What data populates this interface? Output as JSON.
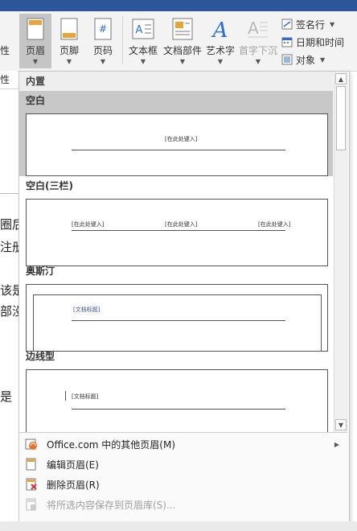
{
  "ribbon": {
    "partial_left_label": "性",
    "buttons": [
      {
        "label": "页眉",
        "icon": "header-icon",
        "active": true
      },
      {
        "label": "页脚",
        "icon": "footer-icon",
        "active": false
      },
      {
        "label": "页码",
        "icon": "page-number-icon",
        "active": false
      },
      {
        "label": "文本框",
        "icon": "text-box-icon",
        "active": false
      },
      {
        "label": "文档部件",
        "icon": "quick-parts-icon",
        "active": false
      },
      {
        "label": "艺术字",
        "icon": "wordart-icon",
        "active": false
      },
      {
        "label": "首字下沉",
        "icon": "drop-cap-icon",
        "active": false,
        "disabled": true
      }
    ],
    "small_items": [
      {
        "label": "签名行",
        "icon": "signature-line-icon"
      },
      {
        "label": "日期和时间",
        "icon": "date-time-icon"
      },
      {
        "label": "对象",
        "icon": "object-icon"
      }
    ]
  },
  "document_fragments": [
    "圈后",
    "注册",
    "该是",
    "部没有",
    "是"
  ],
  "left_edge_label": "性",
  "dropdown": {
    "section_label": "内置",
    "gallery_items": [
      {
        "title": "空白",
        "selected": true,
        "placeholder": "[在此处键入]"
      },
      {
        "title": "空白(三栏)",
        "selected": false,
        "placeholders": [
          "[在此处键入]",
          "[在此处键入]",
          "[在此处键入]"
        ]
      },
      {
        "title": "奥斯汀",
        "selected": false,
        "placeholder": "[文档标题]"
      },
      {
        "title": "边线型",
        "selected": false,
        "placeholder": "[文档标题]"
      }
    ],
    "menu_items": [
      {
        "label": "Office.com 中的其他页眉(M)",
        "icon": "office-icon",
        "has_submenu": true,
        "disabled": false
      },
      {
        "label": "编辑页眉(E)",
        "icon": "edit-header-icon",
        "has_submenu": false,
        "disabled": false
      },
      {
        "label": "删除页眉(R)",
        "icon": "remove-header-icon",
        "has_submenu": false,
        "disabled": false
      },
      {
        "label": "将所选内容保存到页眉库(S)...",
        "icon": "save-selection-icon",
        "has_submenu": false,
        "disabled": true
      }
    ]
  },
  "colors": {
    "title_bar": "#2b579a",
    "selected_bg": "#c8c8c8",
    "accent_blue": "#2e6dd1",
    "delete_red": "#d13438"
  }
}
